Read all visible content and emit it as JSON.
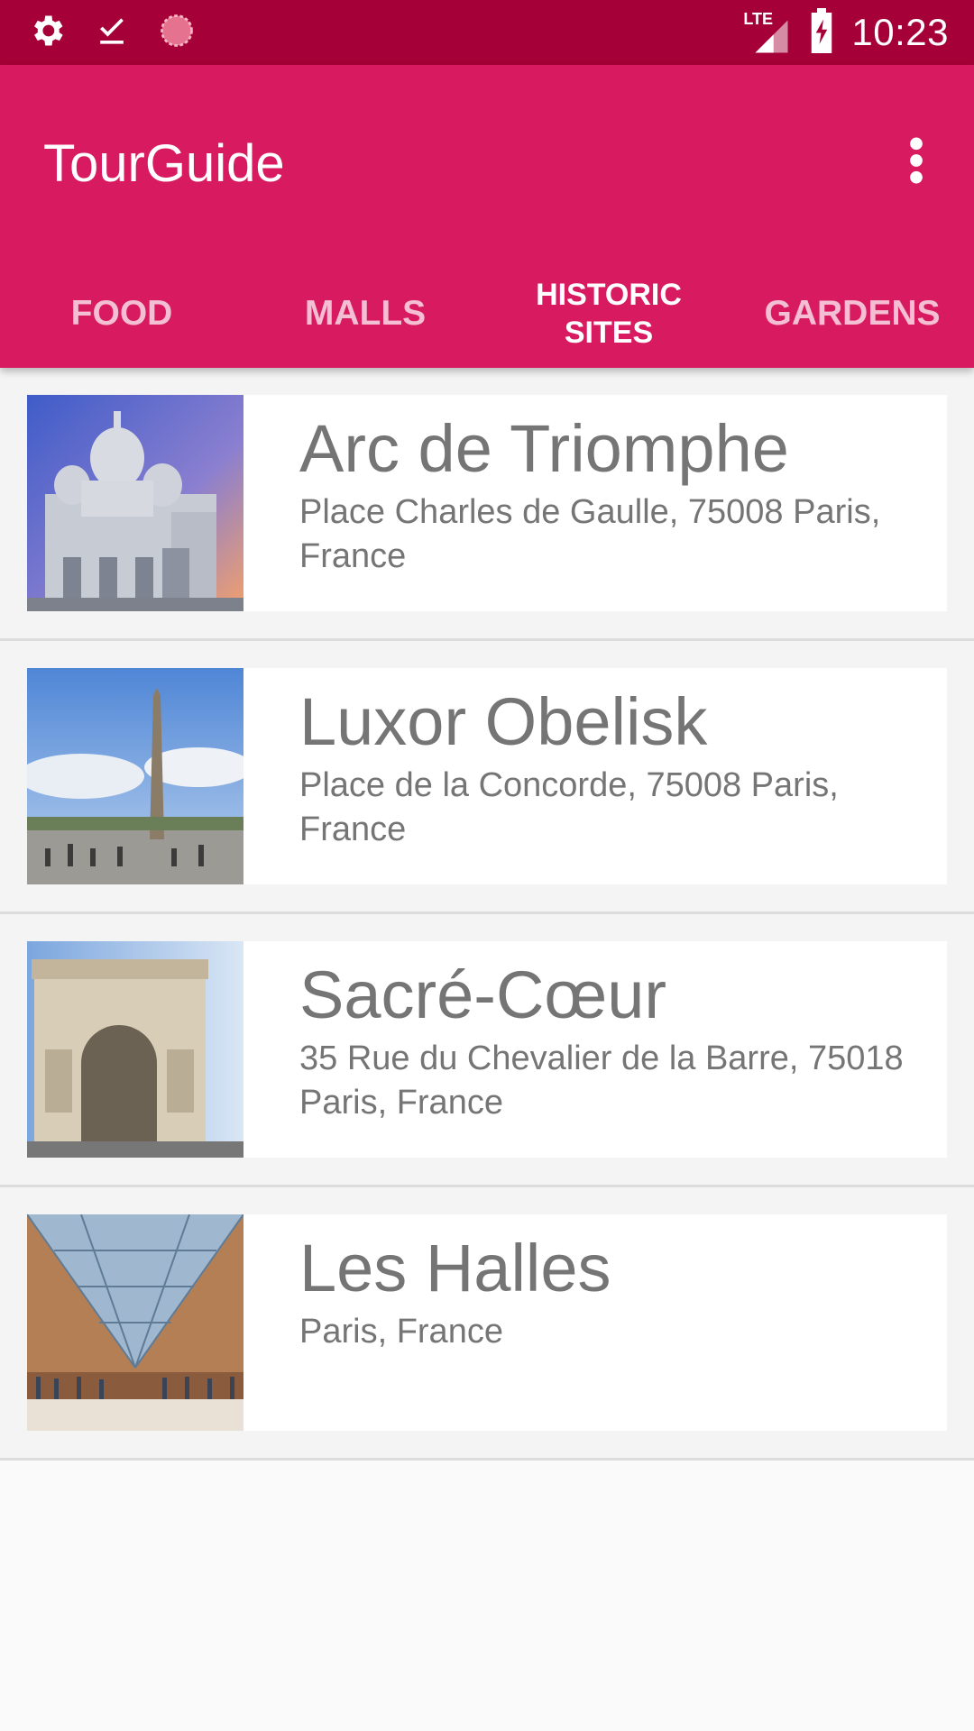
{
  "status_bar": {
    "time": "10:23",
    "network_label": "LTE",
    "left_icons": [
      "gear-icon",
      "download-done-icon",
      "sync-icon"
    ],
    "right_icons": [
      "signal-icon",
      "battery-charging-icon"
    ]
  },
  "app_bar": {
    "title": "TourGuide",
    "color": "#d81b60",
    "status_color": "#a50037"
  },
  "tabs": [
    {
      "label": "FOOD",
      "selected": false
    },
    {
      "label": "MALLS",
      "selected": false
    },
    {
      "label": "HISTORIC SITES",
      "selected": true
    },
    {
      "label": "GARDENS",
      "selected": false
    }
  ],
  "places": [
    {
      "name": "Arc de Triomphe",
      "address": "Place Charles de Gaulle, 75008 Paris, France",
      "image": "basilica-photo"
    },
    {
      "name": "Luxor Obelisk",
      "address": "Place de la Concorde, 75008 Paris, France",
      "image": "obelisk-photo"
    },
    {
      "name": "Sacré-Cœur",
      "address": "35 Rue du Chevalier de la Barre, 75018 Paris, France",
      "image": "triumphal-arch-photo"
    },
    {
      "name": "Les Halles",
      "address": "Paris, France",
      "image": "glass-pyramid-photo"
    }
  ]
}
